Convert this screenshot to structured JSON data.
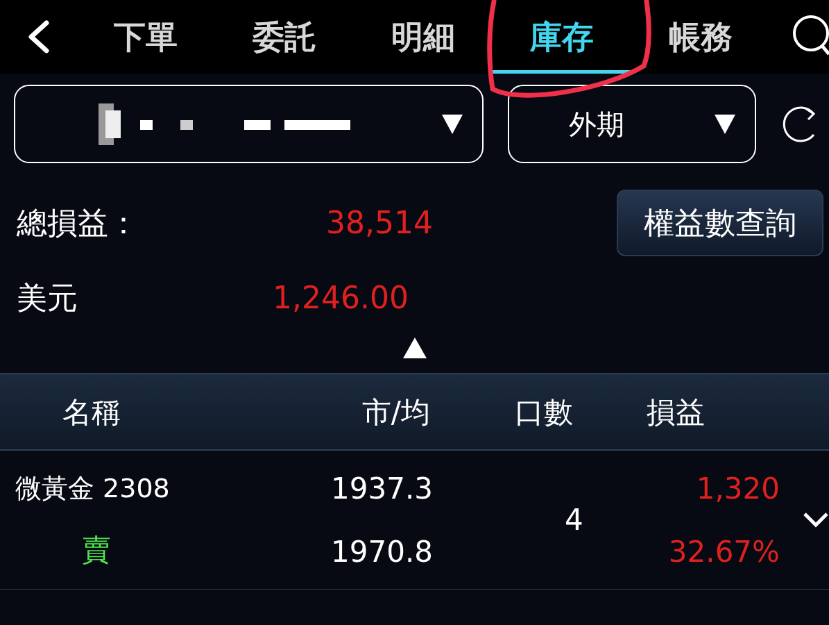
{
  "nav": {
    "tabs": [
      {
        "label": "下單",
        "selected": false
      },
      {
        "label": "委託",
        "selected": false
      },
      {
        "label": "明細",
        "selected": false
      },
      {
        "label": "庫存",
        "selected": true
      },
      {
        "label": "帳務",
        "selected": false
      }
    ]
  },
  "market_select": {
    "value": "外期"
  },
  "summary": {
    "total_label": "總損益：",
    "total_value": "38,514",
    "currency": "美元",
    "currency_value": "1,246.00",
    "query_button": "權益數查詢"
  },
  "table": {
    "columns": [
      "名稱",
      "市/均",
      "口數",
      "損益"
    ],
    "rows": [
      {
        "name": "微黃金 2308",
        "side": "賣",
        "kind": "sell",
        "market": "1937.3",
        "average": "1970.8",
        "lots": "4",
        "pnl": "1,320",
        "pnl_pct": "32.67%",
        "color": "#e02020",
        "expanded": false
      }
    ]
  }
}
